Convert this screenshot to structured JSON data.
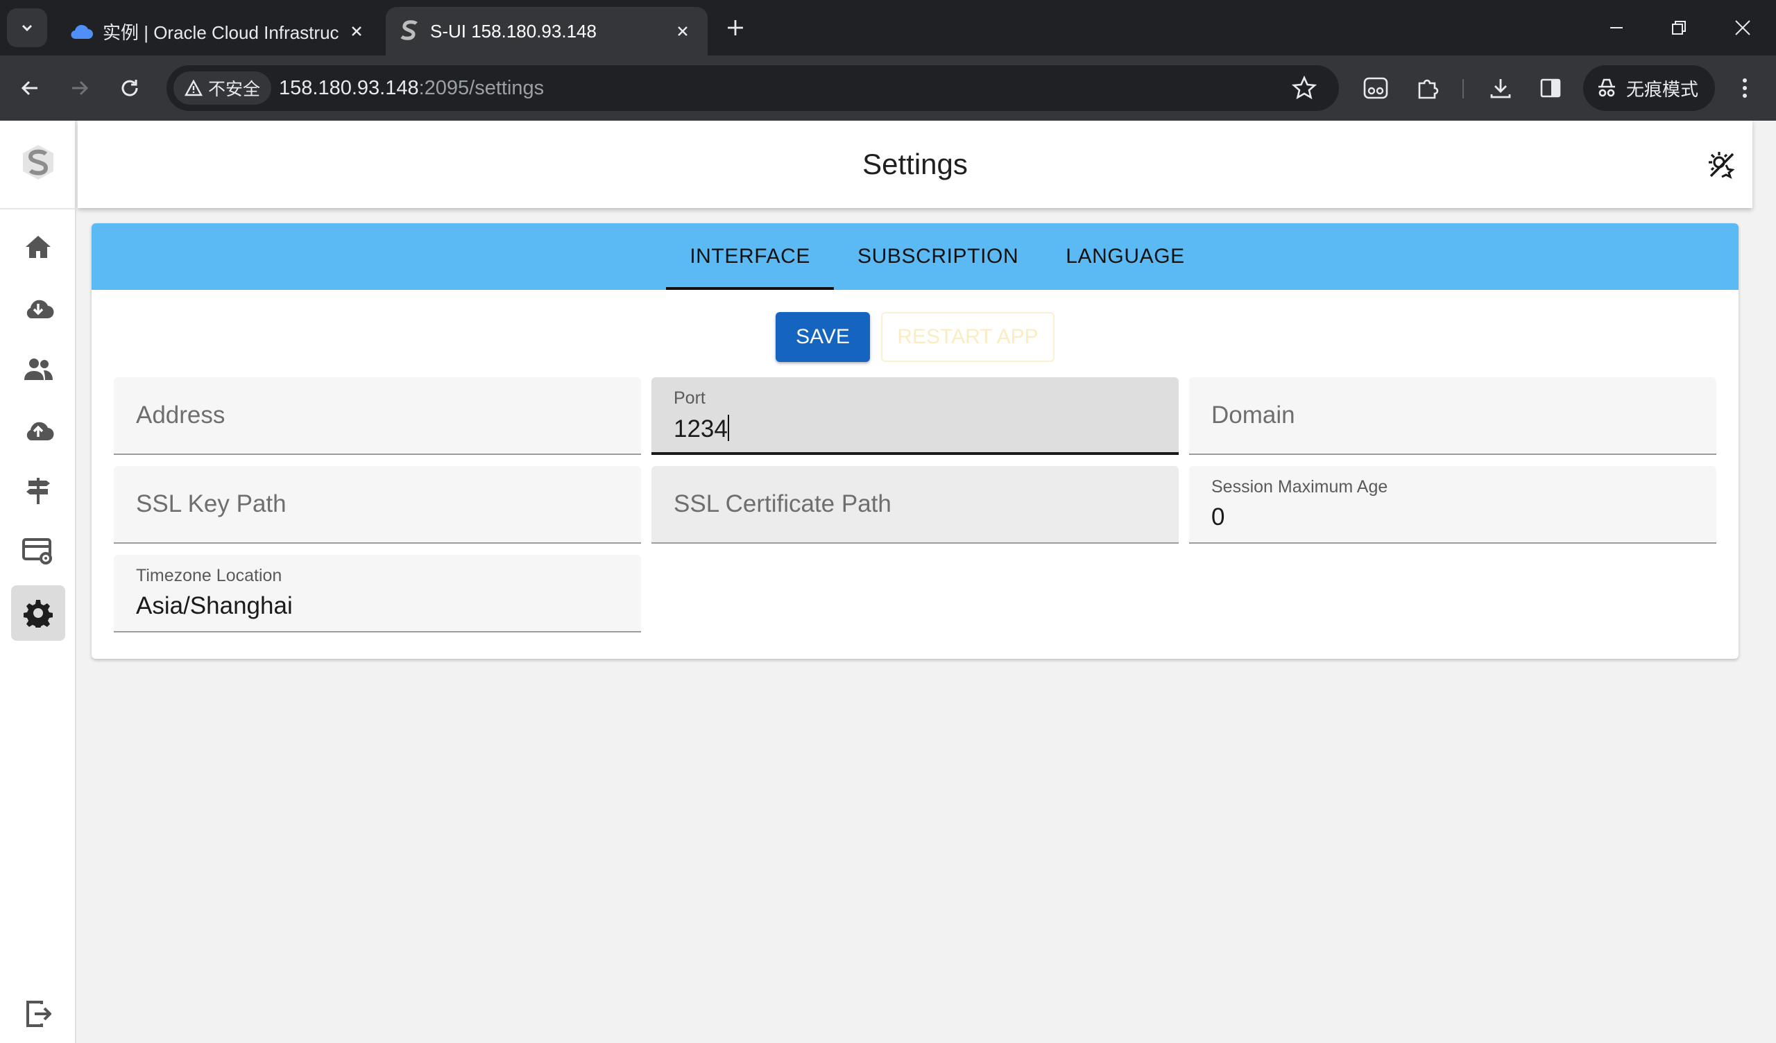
{
  "browser": {
    "tabs": [
      {
        "title": "实例 | Oracle Cloud Infrastruc",
        "active": false,
        "icon": "cloud-icon"
      },
      {
        "title": "S-UI 158.180.93.148",
        "active": true,
        "icon": "s-ui-favicon"
      }
    ],
    "security_label": "不安全",
    "url_host": "158.180.93.148",
    "url_rest": ":2095/settings",
    "incognito_label": "无痕模式"
  },
  "app": {
    "page_title": "Settings",
    "sidebar_items": [
      "home-icon",
      "cloud-download-icon",
      "users-icon",
      "cloud-upload-icon",
      "signpost-icon",
      "server-settings-icon",
      "settings-gear-icon"
    ],
    "active_sidebar_item": "settings-gear-icon",
    "logout_icon": "logout-icon"
  },
  "settings": {
    "tabs": [
      "INTERFACE",
      "SUBSCRIPTION",
      "LANGUAGE"
    ],
    "active_tab": "INTERFACE",
    "save_label": "SAVE",
    "restart_label": "RESTART APP",
    "fields": {
      "address": {
        "placeholder": "Address"
      },
      "port": {
        "label": "Port",
        "value": "1234"
      },
      "domain": {
        "placeholder": "Domain"
      },
      "ssl_key_path": {
        "placeholder": "SSL Key Path"
      },
      "ssl_cert_path": {
        "placeholder": "SSL Certificate Path"
      },
      "session_max_age": {
        "label": "Session Maximum Age",
        "value": "0"
      },
      "timezone": {
        "label": "Timezone Location",
        "value": "Asia/Shanghai"
      }
    }
  },
  "colors": {
    "tab_bar": "#5bbaf4",
    "save_button": "#1565c0",
    "restart_button_text": "#fbedc2"
  }
}
